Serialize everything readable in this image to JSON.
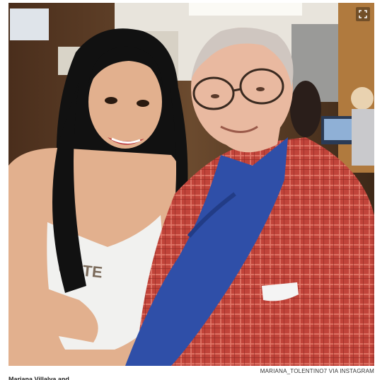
{
  "photo": {
    "alt": "",
    "shirt_text": "OOTE",
    "colors": {
      "wall": "#6b4a2e",
      "ceiling": "#e8e4dc",
      "hair": "#111111",
      "skin_woman": "#e2b08e",
      "skin_man": "#e9b9a0",
      "tank_top": "#f1f1ef",
      "plaid_shirt": "#c1443a",
      "blue_shirt": "#2f4fa8"
    }
  },
  "expand_icon": "expand-icon",
  "credit": "MARIANA_TOLENTINO7 VIA INSTAGRAM",
  "caption": "Mariana Villalva and ..."
}
